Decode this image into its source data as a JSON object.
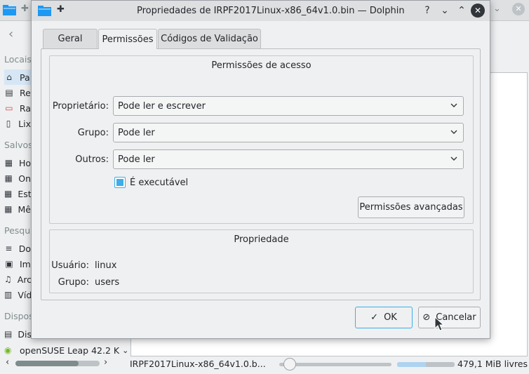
{
  "background": {
    "sections": {
      "places": "Locais",
      "saved": "Salvos",
      "search": "Pesqu",
      "devices": "Dispos"
    },
    "places": [
      {
        "label": "Pa",
        "icon": "home-icon"
      },
      {
        "label": "Re",
        "icon": "network-icon"
      },
      {
        "label": "Ra",
        "icon": "root-folder-icon"
      },
      {
        "label": "Lix",
        "icon": "trash-icon"
      }
    ],
    "saved": [
      {
        "label": "Ho",
        "icon": "calendar-icon"
      },
      {
        "label": "On",
        "icon": "calendar-icon"
      },
      {
        "label": "Est",
        "icon": "calendar-icon"
      },
      {
        "label": "Mê",
        "icon": "calendar-icon"
      }
    ],
    "search": [
      {
        "label": "Do",
        "icon": "document-icon"
      },
      {
        "label": "Im",
        "icon": "image-icon"
      },
      {
        "label": "Arc",
        "icon": "music-icon"
      },
      {
        "label": "Víd",
        "icon": "video-icon"
      }
    ],
    "devices": [
      {
        "label": "Dis",
        "icon": "drive-icon"
      },
      {
        "label": "openSUSE Leap 42.2 K",
        "icon": "opensuse-icon"
      }
    ],
    "status": {
      "filename": "IRPF2017Linux-x86_64v1.0.b...",
      "free_space": "479,1 MiB livres",
      "space_used_fraction": 0.5,
      "zoom_fraction": 0.05
    }
  },
  "dialog": {
    "title": "Propriedades de IRPF2017Linux-x86_64v1.0.bin — Dolphin",
    "tabs": [
      {
        "label": "Geral",
        "active": false
      },
      {
        "label": "Permissões",
        "active": true
      },
      {
        "label": "Códigos de Validação",
        "active": false
      }
    ],
    "access": {
      "title": "Permissões de acesso",
      "owner_label": "Proprietário:",
      "owner_value": "Pode ler e escrever",
      "group_label": "Grupo:",
      "group_value": "Pode ler",
      "others_label": "Outros:",
      "others_value": "Pode ler",
      "executable_label": "É executável",
      "executable_checked": true,
      "advanced_button": "Permissões avançadas"
    },
    "ownership": {
      "title": "Propriedade",
      "user_label": "Usuário:",
      "user_value": "linux",
      "group_label": "Grupo:",
      "group_value": "users"
    },
    "buttons": {
      "ok": "OK",
      "cancel": "Cancelar"
    }
  },
  "colors": {
    "accent": "#3daee9",
    "window_bg": "#eff0f1",
    "text": "#232629"
  }
}
